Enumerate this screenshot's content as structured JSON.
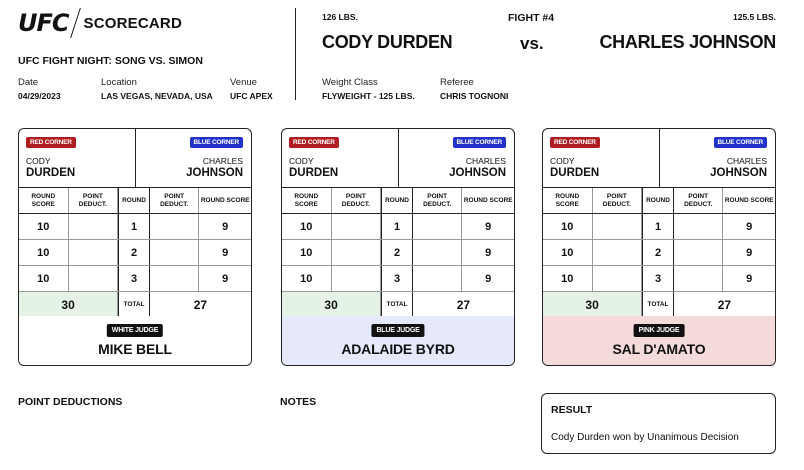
{
  "header": {
    "logo": "UFC",
    "doc_title": "SCORECARD",
    "event_title": "UFC FIGHT NIGHT: SONG VS. SIMON",
    "date_label": "Date",
    "date": "04/29/2023",
    "location_label": "Location",
    "location": "LAS VEGAS, NEVADA, USA",
    "venue_label": "Venue",
    "venue": "UFC APEX"
  },
  "fight": {
    "red_weight": "126 LBS.",
    "blue_weight": "125.5 LBS.",
    "fight_number": "FIGHT #4",
    "red_name": "CODY DURDEN",
    "blue_name": "CHARLES JOHNSON",
    "vs": "vs.",
    "weight_class_label": "Weight Class",
    "weight_class": "FLYWEIGHT - 125 LBS.",
    "referee_label": "Referee",
    "referee": "CHRIS TOGNONI"
  },
  "card_labels": {
    "red_corner": "RED CORNER",
    "blue_corner": "BLUE CORNER",
    "red_first": "CODY",
    "red_last": "DURDEN",
    "blue_first": "CHARLES",
    "blue_last": "JOHNSON",
    "round_score": "ROUND SCORE",
    "point_deduct": "POINT DEDUCT.",
    "round": "ROUND",
    "total": "TOTAL"
  },
  "scorecards": [
    {
      "judge_tag": "WHITE JUDGE",
      "judge_name": "MIKE BELL",
      "judge_bg": "#ffffff",
      "rounds": [
        {
          "round": "1",
          "red": "10",
          "blue": "9",
          "red_ded": "",
          "blue_ded": ""
        },
        {
          "round": "2",
          "red": "10",
          "blue": "9",
          "red_ded": "",
          "blue_ded": ""
        },
        {
          "round": "3",
          "red": "10",
          "blue": "9",
          "red_ded": "",
          "blue_ded": ""
        }
      ],
      "red_total": "30",
      "blue_total": "27"
    },
    {
      "judge_tag": "BLUE JUDGE",
      "judge_name": "ADALAIDE BYRD",
      "judge_bg": "#e5e9fb",
      "rounds": [
        {
          "round": "1",
          "red": "10",
          "blue": "9",
          "red_ded": "",
          "blue_ded": ""
        },
        {
          "round": "2",
          "red": "10",
          "blue": "9",
          "red_ded": "",
          "blue_ded": ""
        },
        {
          "round": "3",
          "red": "10",
          "blue": "9",
          "red_ded": "",
          "blue_ded": ""
        }
      ],
      "red_total": "30",
      "blue_total": "27"
    },
    {
      "judge_tag": "PINK JUDGE",
      "judge_name": "SAL D'AMATO",
      "judge_bg": "#f5dada",
      "rounds": [
        {
          "round": "1",
          "red": "10",
          "blue": "9",
          "red_ded": "",
          "blue_ded": ""
        },
        {
          "round": "2",
          "red": "10",
          "blue": "9",
          "red_ded": "",
          "blue_ded": ""
        },
        {
          "round": "3",
          "red": "10",
          "blue": "9",
          "red_ded": "",
          "blue_ded": ""
        }
      ],
      "red_total": "30",
      "blue_total": "27"
    }
  ],
  "footer": {
    "point_deductions_label": "POINT DEDUCTIONS",
    "notes_label": "NOTES",
    "result_label": "RESULT",
    "result_text": "Cody Durden won by Unanimous Decision"
  }
}
